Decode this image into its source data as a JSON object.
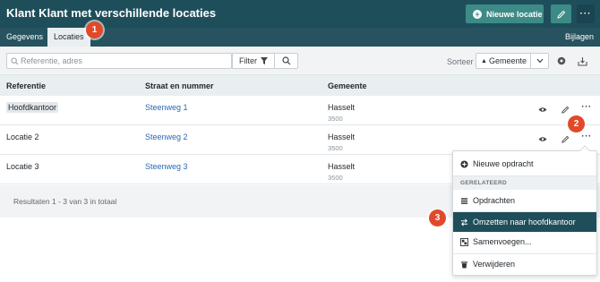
{
  "header": {
    "title": "Klant Klant met verschillende locaties",
    "new_location_label": "Nieuwe locatie"
  },
  "tabs": [
    {
      "label": "Gegevens",
      "active": false
    },
    {
      "label": "Locaties",
      "active": true
    }
  ],
  "tab_right": "Bijlagen",
  "toolbar": {
    "search_placeholder": "Referentie, adres",
    "filter_label": "Filter",
    "sort_label": "Sorteer",
    "sort_value": "Gemeente"
  },
  "table": {
    "columns": [
      "Referentie",
      "Straat en nummer",
      "Gemeente"
    ],
    "rows": [
      {
        "reference": "Hoofdkantoor",
        "street": "Steenweg 1",
        "city": "Hasselt",
        "zip": "3500"
      },
      {
        "reference": "Locatie 2",
        "street": "Steenweg 2",
        "city": "Hasselt",
        "zip": "3500"
      },
      {
        "reference": "Locatie 3",
        "street": "Steenweg 3",
        "city": "Hasselt",
        "zip": "3500"
      }
    ]
  },
  "footer": {
    "results": "Resultaten 1 - 3 van 3 in totaal"
  },
  "menu": {
    "new_order": "Nieuwe opdracht",
    "section_related": "GERELATEERD",
    "orders": "Opdrachten",
    "convert": "Omzetten naar hoofdkantoor",
    "merge": "Samenvoegen...",
    "delete": "Verwijderen"
  },
  "callouts": [
    "1",
    "2",
    "3"
  ],
  "colors": {
    "header_bg": "#1f4e5b",
    "accent": "#3d8b86",
    "link": "#2a67b8",
    "callout": "#e04a2a"
  },
  "icons": [
    "plus-circle-icon",
    "pencil-icon",
    "more-icon",
    "search-icon",
    "filter-icon",
    "sort-arrow-icon",
    "chevron-down-icon",
    "settings-icon",
    "export-icon",
    "eye-icon",
    "list-icon",
    "swap-icon",
    "merge-icon",
    "trash-icon"
  ]
}
